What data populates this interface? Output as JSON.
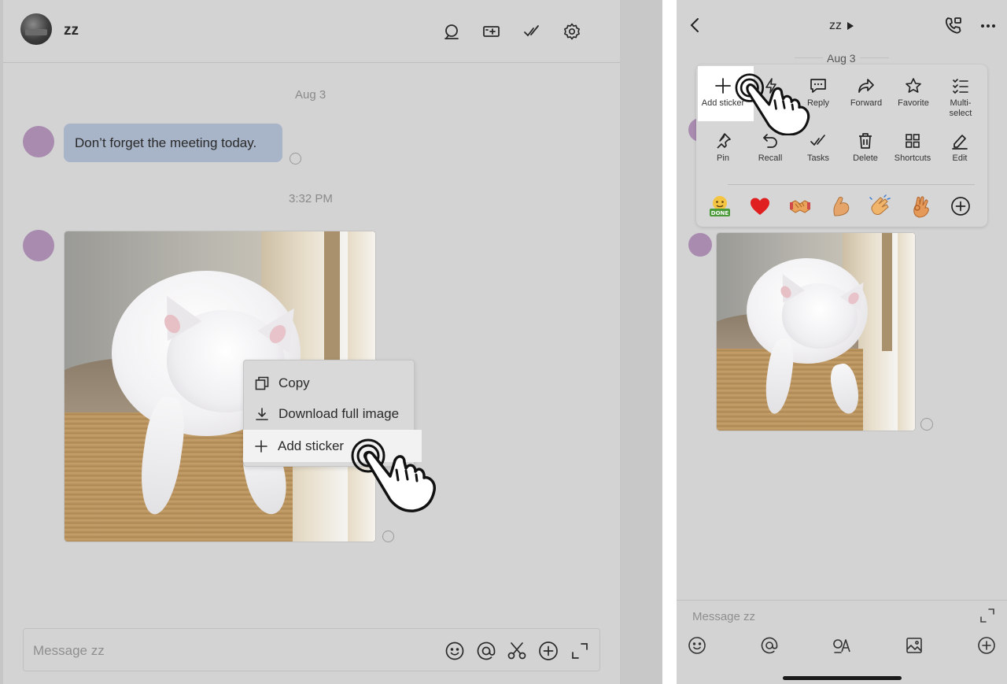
{
  "desktop": {
    "chat_title": "zz",
    "date_separator": "Aug 3",
    "message_text": "Don’t forget the meeting today.",
    "time_separator": "3:32 PM",
    "context_menu": {
      "copy_label": "Copy",
      "download_label": "Download full image",
      "add_sticker_label": "Add sticker"
    },
    "composer_placeholder": "Message zz",
    "header_icons": [
      "search-icon",
      "new-task-icon",
      "tasks-check-icon",
      "settings-gear-icon"
    ],
    "composer_icons": [
      "emoji-icon",
      "mention-icon",
      "scissors-icon",
      "add-circle-icon",
      "expand-icon"
    ]
  },
  "mobile": {
    "chat_title": "zz",
    "date_separator": "Aug 3",
    "actions_row1": [
      "Add sticker",
      "Reply",
      "Forward",
      "Favorite",
      "Multi-select"
    ],
    "actions_row2": [
      "Pin",
      "Recall",
      "Tasks",
      "Delete",
      "Shortcuts",
      "Edit"
    ],
    "reactions": [
      "done-sticker",
      "red-heart",
      "handshake",
      "flexed-biceps",
      "clapping-hands",
      "ok-hand",
      "add-reaction-icon"
    ],
    "composer_placeholder": "Message zz"
  },
  "colors": {
    "background": "#d3d3d3",
    "bubble": "#a8b4c8",
    "avatar": "#a98bb0",
    "highlight": "#ffffff"
  }
}
